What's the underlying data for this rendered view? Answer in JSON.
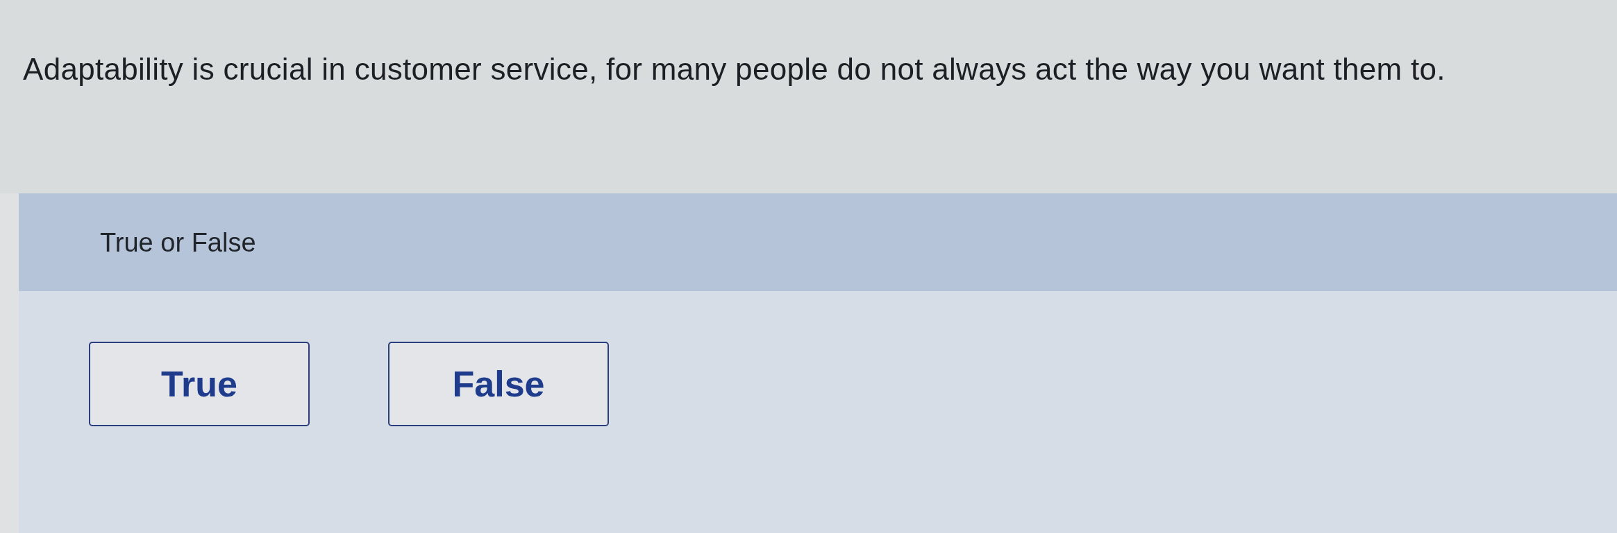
{
  "question": {
    "text": "Adaptability is crucial in customer service, for many people do not always act the way you want them to."
  },
  "answer_panel": {
    "instruction": "True or False",
    "options": [
      {
        "label": "True",
        "selected": false
      },
      {
        "label": "False",
        "selected": false
      }
    ]
  }
}
